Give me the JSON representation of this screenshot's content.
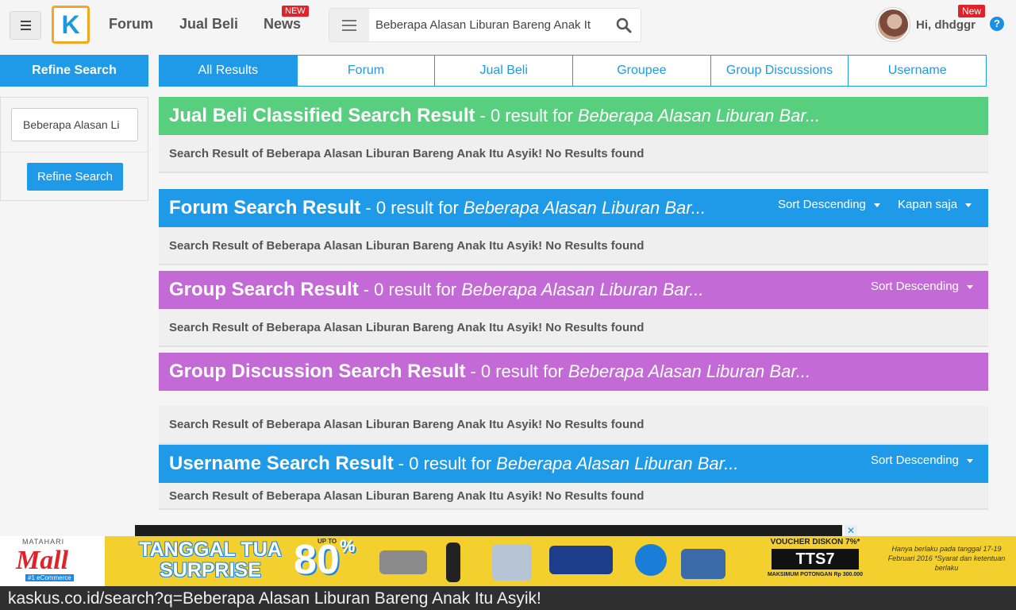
{
  "nav": {
    "logo_letter": "K",
    "forum": "Forum",
    "jual_beli": "Jual Beli",
    "news": "News",
    "news_badge": "NEW",
    "search_value": "Beberapa Alasan Liburan Bareng Anak It",
    "greeting": "Hi, dhdggr",
    "user_badge": "New",
    "help": "?"
  },
  "sidebar": {
    "title": "Refine Search",
    "input_value": "Beberapa Alasan Li",
    "button": "Refine Search"
  },
  "tabs": [
    "All Results",
    "Forum",
    "Jual Beli",
    "Groupee",
    "Group Discussions",
    "Username"
  ],
  "results": [
    {
      "title": "Jual Beli Classified Search Result",
      "count": "- 0 result for",
      "query": "Beberapa Alasan Liburan Bar...",
      "color": "#58cf7e",
      "body": "Search Result of Beberapa Alasan Liburan Bareng Anak Itu Asyik! No Results found"
    },
    {
      "title": "Forum Search Result",
      "count": "- 0 result for",
      "query": "Beberapa Alasan Liburan Bar...",
      "color": "#1e9ae8",
      "sort": "Sort Descending",
      "time": "Kapan saja",
      "body": "Search Result of Beberapa Alasan Liburan Bareng Anak Itu Asyik! No Results found"
    },
    {
      "title": "Group Search Result",
      "count": "- 0 result for",
      "query": "Beberapa Alasan Liburan Bar...",
      "color": "#c36ad6",
      "sort": "Sort Descending",
      "body": "Search Result of Beberapa Alasan Liburan Bareng Anak Itu Asyik! No Results found"
    },
    {
      "title": "Group Discussion Search Result",
      "count": "- 0 result for",
      "query": "Beberapa Alasan Liburan Bar...",
      "color": "#c36ad6",
      "body": "Search Result of Beberapa Alasan Liburan Bareng Anak Itu Asyik! No Results found"
    },
    {
      "title": "Username Search Result",
      "count": "- 0 result for",
      "query": "Beberapa Alasan Liburan Bar...",
      "color": "#1e9ae8",
      "sort": "Sort Descending",
      "body": "Search Result of Beberapa Alasan Liburan Bareng Anak Itu Asyik! No Results found"
    }
  ],
  "ad": {
    "close": "✕",
    "brand_top": "MATAHARI",
    "brand": "Mall",
    "brand_tag": "#1 eCommerce",
    "headline": "TANGGAL TUA SURPRISE",
    "upto": "UP TO",
    "percent": "80",
    "voucher_title": "VOUCHER DISKON 7%*",
    "voucher_code": "TTS7",
    "voucher_max": "MAKSIMUM POTONGAN Rp 300.000",
    "fine_print": "Hanya berlaku pada tanggal 17-19 Februari 2016 *Syarat dan ketentuan berlaku"
  },
  "status_url": "kaskus.co.id/search?q=Beberapa Alasan Liburan Bareng Anak Itu Asyik!"
}
